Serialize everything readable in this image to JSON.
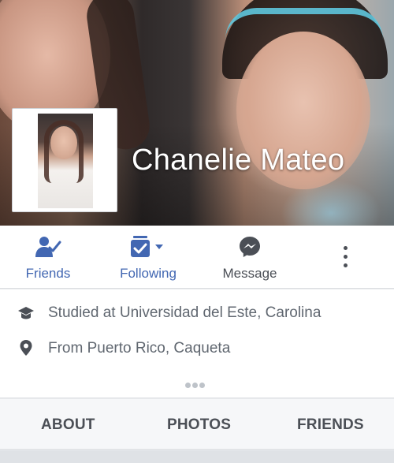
{
  "profile": {
    "name": "Chanelie Mateo"
  },
  "actions": {
    "friends_label": "Friends",
    "following_label": "Following",
    "message_label": "Message"
  },
  "info": {
    "education": "Studied at Universidad del Este, Carolina",
    "hometown": "From Puerto Rico, Caqueta"
  },
  "tabs": [
    "ABOUT",
    "PHOTOS",
    "FRIENDS"
  ],
  "colors": {
    "accent": "#4267b2",
    "text_secondary": "#606770",
    "tab_background": "#f6f7f9"
  },
  "icons": {
    "friends": "friend-check-icon",
    "following": "following-check-icon",
    "message": "messenger-icon",
    "more": "vertical-ellipsis-icon",
    "education": "graduation-cap-icon",
    "hometown": "location-pin-icon"
  }
}
